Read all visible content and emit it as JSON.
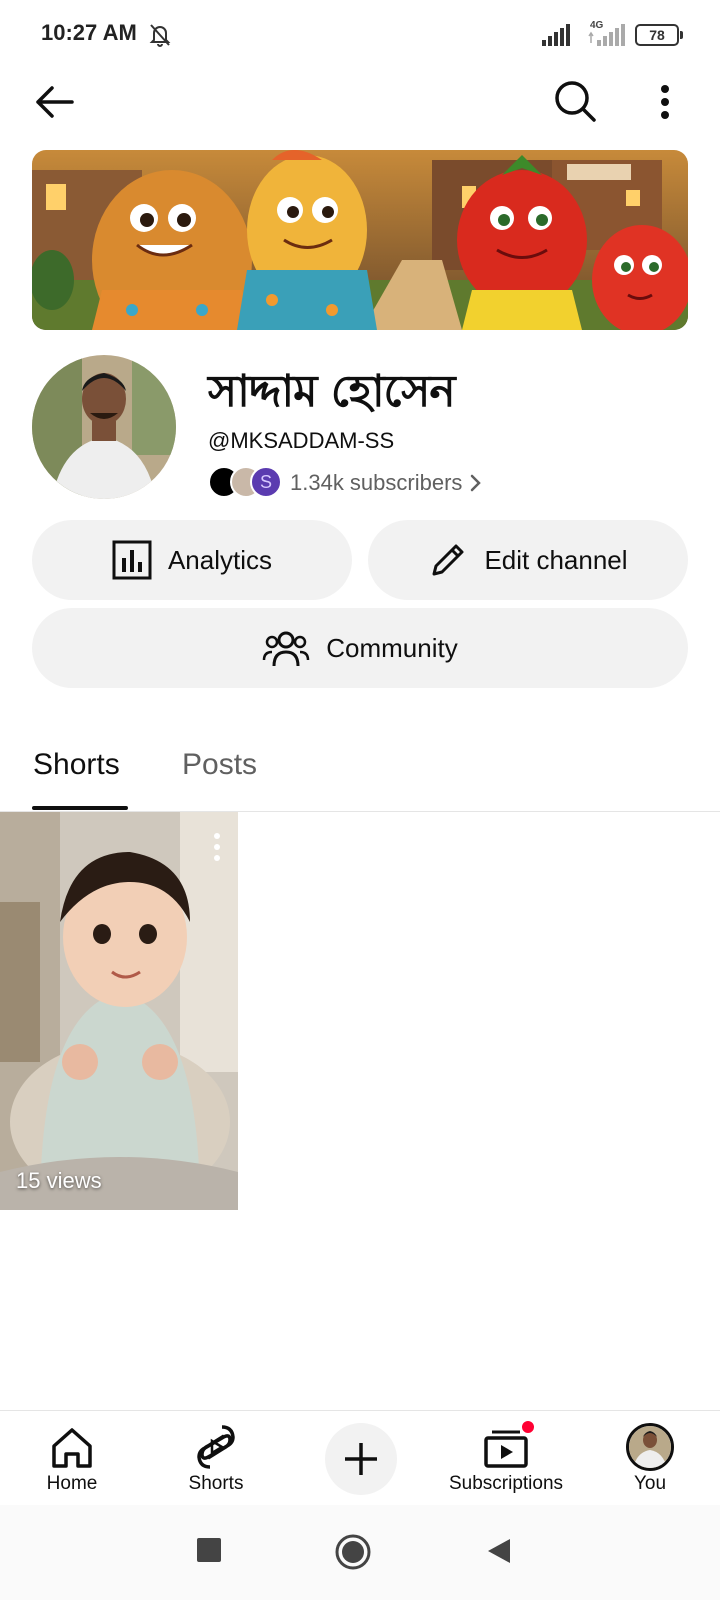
{
  "status_bar": {
    "time": "10:27 AM",
    "network": "4G",
    "battery": "78",
    "icons": [
      "bell-off-icon",
      "signal-icon",
      "signal-4g-icon",
      "battery-icon"
    ]
  },
  "top_bar": {
    "icons": [
      "back-arrow-icon",
      "search-icon",
      "more-vert-icon"
    ]
  },
  "channel": {
    "name": "সাদ্দাম হোসেন",
    "handle": "@MKSADDAM-SS",
    "subscribers": "1.34k subscribers",
    "mini_avatar_letter": "S"
  },
  "actions": {
    "analytics_label": "Analytics",
    "edit_label": "Edit channel",
    "community_label": "Community"
  },
  "tabs": [
    {
      "label": "Shorts",
      "selected": true
    },
    {
      "label": "Posts",
      "selected": false
    }
  ],
  "shorts": [
    {
      "views": "15 views"
    }
  ],
  "bottom_nav": {
    "home": "Home",
    "shorts": "Shorts",
    "subscriptions": "Subscriptions",
    "you": "You"
  },
  "colors": {
    "accent_red": "#ff0033",
    "pill_bg": "#f2f2f2",
    "text_primary": "#0f0f0f",
    "text_secondary": "#606060"
  }
}
